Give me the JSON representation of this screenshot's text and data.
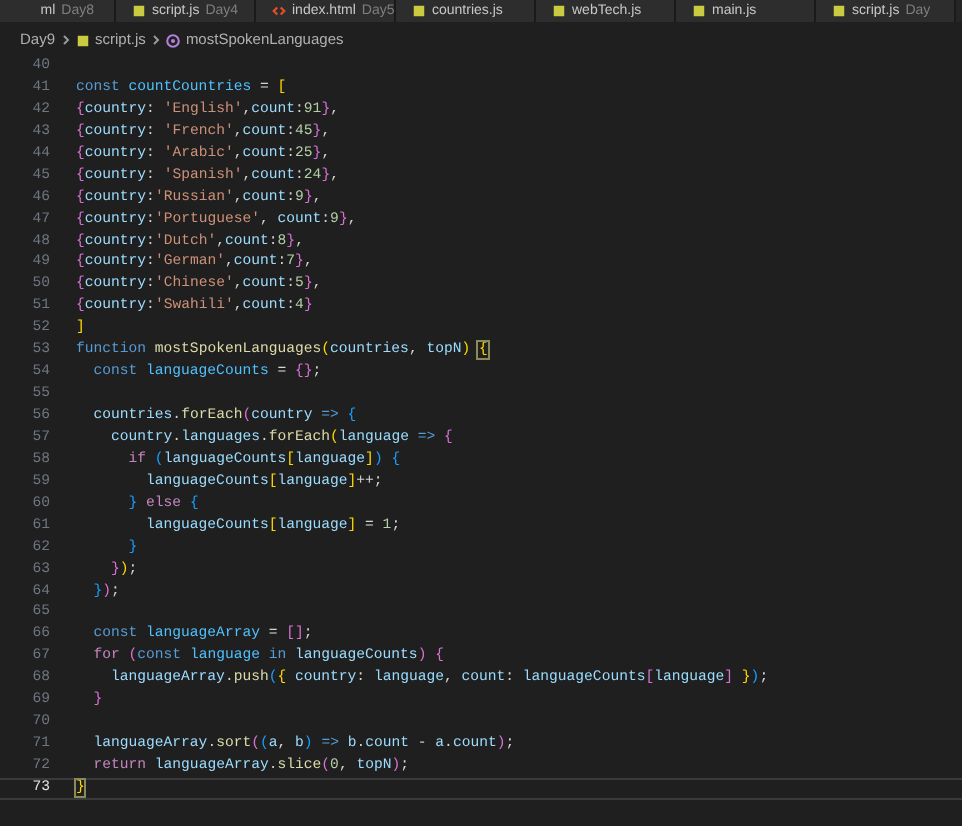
{
  "tabs": [
    {
      "label": "ml",
      "folder": "Day8",
      "kind": "none"
    },
    {
      "label": "script.js",
      "folder": "Day4",
      "kind": "js"
    },
    {
      "label": "index.html",
      "folder": "Day5",
      "kind": "html"
    },
    {
      "label": "countries.js",
      "kind": "js"
    },
    {
      "label": "webTech.js",
      "kind": "js"
    },
    {
      "label": "main.js",
      "kind": "js"
    },
    {
      "label": "script.js",
      "folder": "Day",
      "kind": "js"
    }
  ],
  "breadcrumb": [
    {
      "text": "Day9",
      "kind": "folder"
    },
    {
      "text": "script.js",
      "kind": "js"
    },
    {
      "text": "mostSpokenLanguages",
      "kind": "function"
    }
  ],
  "editor": {
    "lines": [
      {
        "number": "40",
        "current": false
      },
      {
        "number": "41",
        "current": false,
        "tokens": [
          {
            "kind": "kw",
            "text": "const "
          },
          {
            "kind": "const",
            "text": "countCountries"
          },
          {
            "kind": "op",
            "text": " = "
          },
          {
            "kind": "b1",
            "text": "["
          }
        ]
      },
      {
        "number": "42",
        "current": false,
        "tokens": [
          {
            "kind": "b2",
            "text": "{"
          },
          {
            "kind": "prop",
            "text": "country"
          },
          {
            "kind": "op",
            "text": ": "
          },
          {
            "kind": "str",
            "text": "'English'"
          },
          {
            "kind": "op",
            "text": ","
          },
          {
            "kind": "prop",
            "text": "count"
          },
          {
            "kind": "op",
            "text": ":"
          },
          {
            "kind": "num",
            "text": "91"
          },
          {
            "kind": "b2",
            "text": "}"
          },
          {
            "kind": "op",
            "text": ","
          }
        ]
      },
      {
        "number": "43",
        "current": false,
        "tokens": [
          {
            "kind": "b2",
            "text": "{"
          },
          {
            "kind": "prop",
            "text": "country"
          },
          {
            "kind": "op",
            "text": ": "
          },
          {
            "kind": "str",
            "text": "'French'"
          },
          {
            "kind": "op",
            "text": ","
          },
          {
            "kind": "prop",
            "text": "count"
          },
          {
            "kind": "op",
            "text": ":"
          },
          {
            "kind": "num",
            "text": "45"
          },
          {
            "kind": "b2",
            "text": "}"
          },
          {
            "kind": "op",
            "text": ","
          }
        ]
      },
      {
        "number": "44",
        "current": false,
        "tokens": [
          {
            "kind": "b2",
            "text": "{"
          },
          {
            "kind": "prop",
            "text": "country"
          },
          {
            "kind": "op",
            "text": ": "
          },
          {
            "kind": "str",
            "text": "'Arabic'"
          },
          {
            "kind": "op",
            "text": ","
          },
          {
            "kind": "prop",
            "text": "count"
          },
          {
            "kind": "op",
            "text": ":"
          },
          {
            "kind": "num",
            "text": "25"
          },
          {
            "kind": "b2",
            "text": "}"
          },
          {
            "kind": "op",
            "text": ","
          }
        ]
      },
      {
        "number": "45",
        "current": false,
        "tokens": [
          {
            "kind": "b2",
            "text": "{"
          },
          {
            "kind": "prop",
            "text": "country"
          },
          {
            "kind": "op",
            "text": ": "
          },
          {
            "kind": "str",
            "text": "'Spanish'"
          },
          {
            "kind": "op",
            "text": ","
          },
          {
            "kind": "prop",
            "text": "count"
          },
          {
            "kind": "op",
            "text": ":"
          },
          {
            "kind": "num",
            "text": "24"
          },
          {
            "kind": "b2",
            "text": "}"
          },
          {
            "kind": "op",
            "text": ","
          }
        ]
      },
      {
        "number": "46",
        "current": false,
        "tokens": [
          {
            "kind": "b2",
            "text": "{"
          },
          {
            "kind": "prop",
            "text": "country"
          },
          {
            "kind": "op",
            "text": ":"
          },
          {
            "kind": "str",
            "text": "'Russian'"
          },
          {
            "kind": "op",
            "text": ","
          },
          {
            "kind": "prop",
            "text": "count"
          },
          {
            "kind": "op",
            "text": ":"
          },
          {
            "kind": "num",
            "text": "9"
          },
          {
            "kind": "b2",
            "text": "}"
          },
          {
            "kind": "op",
            "text": ","
          }
        ]
      },
      {
        "number": "47",
        "current": false,
        "tokens": [
          {
            "kind": "b2",
            "text": "{"
          },
          {
            "kind": "prop",
            "text": "country"
          },
          {
            "kind": "op",
            "text": ":"
          },
          {
            "kind": "str",
            "text": "'Portuguese'"
          },
          {
            "kind": "op",
            "text": ", "
          },
          {
            "kind": "prop",
            "text": "count"
          },
          {
            "kind": "op",
            "text": ":"
          },
          {
            "kind": "num",
            "text": "9"
          },
          {
            "kind": "b2",
            "text": "}"
          },
          {
            "kind": "op",
            "text": ","
          }
        ]
      },
      {
        "number": "48",
        "current": false,
        "tokens": [
          {
            "kind": "b2",
            "text": "{"
          },
          {
            "kind": "prop",
            "text": "country"
          },
          {
            "kind": "op",
            "text": ":"
          },
          {
            "kind": "str",
            "text": "'Dutch'"
          },
          {
            "kind": "op",
            "text": ","
          },
          {
            "kind": "prop",
            "text": "count"
          },
          {
            "kind": "op",
            "text": ":"
          },
          {
            "kind": "num",
            "text": "8"
          },
          {
            "kind": "b2",
            "text": "}"
          },
          {
            "kind": "op",
            "text": ","
          }
        ]
      },
      {
        "number": "49",
        "current": false,
        "tokens": [
          {
            "kind": "b2",
            "text": "{"
          },
          {
            "kind": "prop",
            "text": "country"
          },
          {
            "kind": "op",
            "text": ":"
          },
          {
            "kind": "str",
            "text": "'German'"
          },
          {
            "kind": "op",
            "text": ","
          },
          {
            "kind": "prop",
            "text": "count"
          },
          {
            "kind": "op",
            "text": ":"
          },
          {
            "kind": "num",
            "text": "7"
          },
          {
            "kind": "b2",
            "text": "}"
          },
          {
            "kind": "op",
            "text": ","
          }
        ]
      },
      {
        "number": "50",
        "current": false,
        "tokens": [
          {
            "kind": "b2",
            "text": "{"
          },
          {
            "kind": "prop",
            "text": "country"
          },
          {
            "kind": "op",
            "text": ":"
          },
          {
            "kind": "str",
            "text": "'Chinese'"
          },
          {
            "kind": "op",
            "text": ","
          },
          {
            "kind": "prop",
            "text": "count"
          },
          {
            "kind": "op",
            "text": ":"
          },
          {
            "kind": "num",
            "text": "5"
          },
          {
            "kind": "b2",
            "text": "}"
          },
          {
            "kind": "op",
            "text": ","
          }
        ]
      },
      {
        "number": "51",
        "current": false,
        "tokens": [
          {
            "kind": "b2",
            "text": "{"
          },
          {
            "kind": "prop",
            "text": "country"
          },
          {
            "kind": "op",
            "text": ":"
          },
          {
            "kind": "str",
            "text": "'Swahili'"
          },
          {
            "kind": "op",
            "text": ","
          },
          {
            "kind": "prop",
            "text": "count"
          },
          {
            "kind": "op",
            "text": ":"
          },
          {
            "kind": "num",
            "text": "4"
          },
          {
            "kind": "b2",
            "text": "}"
          }
        ]
      },
      {
        "number": "52",
        "current": false,
        "tokens": [
          {
            "kind": "b1",
            "text": "]"
          }
        ]
      },
      {
        "number": "53",
        "current": false,
        "tokens": [
          {
            "kind": "kw",
            "text": "function "
          },
          {
            "kind": "fn",
            "text": "mostSpokenLanguages"
          },
          {
            "kind": "b1",
            "text": "("
          },
          {
            "kind": "prop",
            "text": "countries"
          },
          {
            "kind": "op",
            "text": ", "
          },
          {
            "kind": "prop",
            "text": "topN"
          },
          {
            "kind": "b1",
            "text": ") "
          },
          {
            "kind": "match",
            "text": "{"
          }
        ]
      },
      {
        "number": "54",
        "current": false,
        "tokens": [
          {
            "kind": "kw",
            "text": "  const "
          },
          {
            "kind": "const",
            "text": "languageCounts"
          },
          {
            "kind": "op",
            "text": " = "
          },
          {
            "kind": "b2",
            "text": "{}"
          },
          {
            "kind": "op",
            "text": ";"
          }
        ]
      },
      {
        "number": "55",
        "current": false
      },
      {
        "number": "56",
        "current": false,
        "tokens": [
          {
            "kind": "prop",
            "text": "  countries"
          },
          {
            "kind": "op",
            "text": "."
          },
          {
            "kind": "fn",
            "text": "forEach"
          },
          {
            "kind": "b2",
            "text": "("
          },
          {
            "kind": "prop",
            "text": "country"
          },
          {
            "kind": "kw",
            "text": " => "
          },
          {
            "kind": "b3",
            "text": "{"
          }
        ]
      },
      {
        "number": "57",
        "current": false,
        "tokens": [
          {
            "kind": "prop",
            "text": "    country"
          },
          {
            "kind": "op",
            "text": "."
          },
          {
            "kind": "prop",
            "text": "languages"
          },
          {
            "kind": "op",
            "text": "."
          },
          {
            "kind": "fn",
            "text": "forEach"
          },
          {
            "kind": "b1",
            "text": "("
          },
          {
            "kind": "prop",
            "text": "language"
          },
          {
            "kind": "kw",
            "text": " => "
          },
          {
            "kind": "b2",
            "text": "{"
          }
        ]
      },
      {
        "number": "58",
        "current": false,
        "tokens": [
          {
            "kind": "ctl",
            "text": "      if "
          },
          {
            "kind": "b3",
            "text": "("
          },
          {
            "kind": "prop",
            "text": "languageCounts"
          },
          {
            "kind": "b1",
            "text": "["
          },
          {
            "kind": "prop",
            "text": "language"
          },
          {
            "kind": "b1",
            "text": "]"
          },
          {
            "kind": "b3",
            "text": ") "
          },
          {
            "kind": "b3",
            "text": "{"
          }
        ]
      },
      {
        "number": "59",
        "current": false,
        "tokens": [
          {
            "kind": "prop",
            "text": "        languageCounts"
          },
          {
            "kind": "b1",
            "text": "["
          },
          {
            "kind": "prop",
            "text": "language"
          },
          {
            "kind": "b1",
            "text": "]"
          },
          {
            "kind": "op",
            "text": "++;"
          }
        ]
      },
      {
        "number": "60",
        "current": false,
        "tokens": [
          {
            "kind": "b3",
            "text": "      }"
          },
          {
            "kind": "ctl",
            "text": " else "
          },
          {
            "kind": "b3",
            "text": "{"
          }
        ]
      },
      {
        "number": "61",
        "current": false,
        "tokens": [
          {
            "kind": "prop",
            "text": "        languageCounts"
          },
          {
            "kind": "b1",
            "text": "["
          },
          {
            "kind": "prop",
            "text": "language"
          },
          {
            "kind": "b1",
            "text": "]"
          },
          {
            "kind": "op",
            "text": " = "
          },
          {
            "kind": "num",
            "text": "1"
          },
          {
            "kind": "op",
            "text": ";"
          }
        ]
      },
      {
        "number": "62",
        "current": false,
        "tokens": [
          {
            "kind": "b3",
            "text": "      }"
          }
        ]
      },
      {
        "number": "63",
        "current": false,
        "tokens": [
          {
            "kind": "b2",
            "text": "    }"
          },
          {
            "kind": "b1",
            "text": ")"
          },
          {
            "kind": "op",
            "text": ";"
          }
        ]
      },
      {
        "number": "64",
        "current": false,
        "tokens": [
          {
            "kind": "b3",
            "text": "  }"
          },
          {
            "kind": "b2",
            "text": ")"
          },
          {
            "kind": "op",
            "text": ";"
          }
        ]
      },
      {
        "number": "65",
        "current": false
      },
      {
        "number": "66",
        "current": false,
        "tokens": [
          {
            "kind": "kw",
            "text": "  const "
          },
          {
            "kind": "const",
            "text": "languageArray"
          },
          {
            "kind": "op",
            "text": " = "
          },
          {
            "kind": "b2",
            "text": "[]"
          },
          {
            "kind": "op",
            "text": ";"
          }
        ]
      },
      {
        "number": "67",
        "current": false,
        "tokens": [
          {
            "kind": "ctl",
            "text": "  for "
          },
          {
            "kind": "b2",
            "text": "("
          },
          {
            "kind": "kw",
            "text": "const "
          },
          {
            "kind": "const",
            "text": "language"
          },
          {
            "kind": "kw",
            "text": " in "
          },
          {
            "kind": "prop",
            "text": "languageCounts"
          },
          {
            "kind": "b2",
            "text": ") "
          },
          {
            "kind": "b2",
            "text": "{"
          }
        ]
      },
      {
        "number": "68",
        "current": false,
        "tokens": [
          {
            "kind": "prop",
            "text": "    languageArray"
          },
          {
            "kind": "op",
            "text": "."
          },
          {
            "kind": "fn",
            "text": "push"
          },
          {
            "kind": "b3",
            "text": "("
          },
          {
            "kind": "b1",
            "text": "{ "
          },
          {
            "kind": "prop",
            "text": "country"
          },
          {
            "kind": "op",
            "text": ": "
          },
          {
            "kind": "prop",
            "text": "language"
          },
          {
            "kind": "op",
            "text": ", "
          },
          {
            "kind": "prop",
            "text": "count"
          },
          {
            "kind": "op",
            "text": ": "
          },
          {
            "kind": "prop",
            "text": "languageCounts"
          },
          {
            "kind": "b2",
            "text": "["
          },
          {
            "kind": "prop",
            "text": "language"
          },
          {
            "kind": "b2",
            "text": "]"
          },
          {
            "kind": "b1",
            "text": " }"
          },
          {
            "kind": "b3",
            "text": ")"
          },
          {
            "kind": "op",
            "text": ";"
          }
        ]
      },
      {
        "number": "69",
        "current": false,
        "tokens": [
          {
            "kind": "b2",
            "text": "  }"
          }
        ]
      },
      {
        "number": "70",
        "current": false
      },
      {
        "number": "71",
        "current": false,
        "tokens": [
          {
            "kind": "prop",
            "text": "  languageArray"
          },
          {
            "kind": "op",
            "text": "."
          },
          {
            "kind": "fn",
            "text": "sort"
          },
          {
            "kind": "b2",
            "text": "("
          },
          {
            "kind": "b3",
            "text": "("
          },
          {
            "kind": "prop",
            "text": "a"
          },
          {
            "kind": "op",
            "text": ", "
          },
          {
            "kind": "prop",
            "text": "b"
          },
          {
            "kind": "b3",
            "text": ")"
          },
          {
            "kind": "kw",
            "text": " => "
          },
          {
            "kind": "prop",
            "text": "b"
          },
          {
            "kind": "op",
            "text": "."
          },
          {
            "kind": "prop",
            "text": "count"
          },
          {
            "kind": "op",
            "text": " - "
          },
          {
            "kind": "prop",
            "text": "a"
          },
          {
            "kind": "op",
            "text": "."
          },
          {
            "kind": "prop",
            "text": "count"
          },
          {
            "kind": "b2",
            "text": ")"
          },
          {
            "kind": "op",
            "text": ";"
          }
        ]
      },
      {
        "number": "72",
        "current": false,
        "tokens": [
          {
            "kind": "ctl",
            "text": "  return "
          },
          {
            "kind": "prop",
            "text": "languageArray"
          },
          {
            "kind": "op",
            "text": "."
          },
          {
            "kind": "fn",
            "text": "slice"
          },
          {
            "kind": "b2",
            "text": "("
          },
          {
            "kind": "num",
            "text": "0"
          },
          {
            "kind": "op",
            "text": ", "
          },
          {
            "kind": "prop",
            "text": "topN"
          },
          {
            "kind": "b2",
            "text": ")"
          },
          {
            "kind": "op",
            "text": ";"
          }
        ]
      },
      {
        "number": "73",
        "current": true,
        "tokens": [
          {
            "kind": "match",
            "text": "}"
          }
        ]
      }
    ]
  }
}
